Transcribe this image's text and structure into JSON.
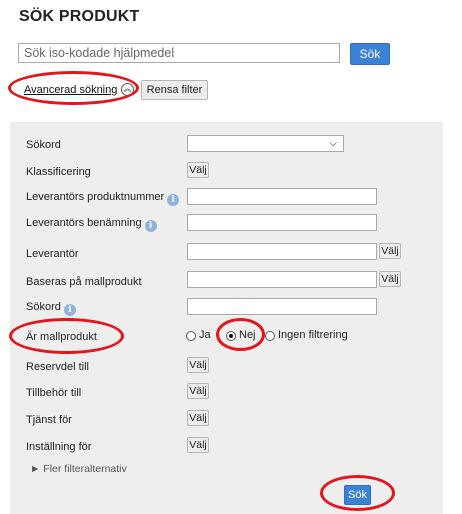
{
  "page": {
    "title": "SÖK PRODUKT"
  },
  "search": {
    "placeholder": "Sök iso-kodade hjälpmedel",
    "button_label": "Sök"
  },
  "advanced": {
    "toggle_label": "Avancerad sökning",
    "toggle_icon": "chevrons-up-circle-icon",
    "clear_label": "Rensa filter"
  },
  "filters": {
    "sokord_select_label": "Sökord",
    "klassificering_label": "Klassificering",
    "lev_produktnummer_label": "Leverantörs produktnummer",
    "lev_benamning_label": "Leverantörs benämning",
    "leverantor_label": "Leverantör",
    "baseras_label": "Baseras på mallprodukt",
    "sokord_text_label": "Sökord",
    "ar_mallprodukt_label": "Är mallprodukt",
    "reservdel_label": "Reservdel till",
    "tillbehor_label": "Tillbehör till",
    "tjanst_label": "Tjänst för",
    "installning_label": "Inställning för",
    "valj_label": "Välj",
    "info_glyph": "i",
    "mallprodukt_options": {
      "ja": "Ja",
      "nej": "Nej",
      "ingen": "Ingen filtrering",
      "selected": "Nej"
    },
    "more_label": "► Fler filteralternativ",
    "search_button_label": "Sök"
  },
  "colors": {
    "accent_blue": "#3b82d6",
    "annotation_red": "#e3141b",
    "panel_bg": "#eeeeee"
  }
}
